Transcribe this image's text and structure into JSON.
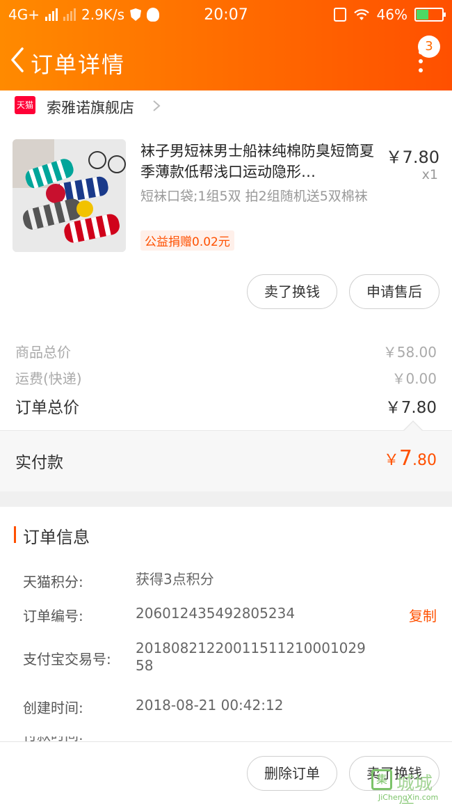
{
  "status_bar": {
    "network": "4G+",
    "speed": "2.9K/s",
    "time": "20:07",
    "battery": "46%",
    "battery_level": 0.46
  },
  "header": {
    "title": "订单详情",
    "badge": "3"
  },
  "shop": {
    "logo_text": "天猫",
    "name": "索雅诺旗舰店"
  },
  "product": {
    "name": "袜子男短袜男士船袜纯棉防臭短筒夏季薄款低帮浅口运动隐形…",
    "price": "￥7.80",
    "quantity": "x1",
    "sku": "短袜口袋;1组5双 拍2组随机送5双棉袜",
    "charity": "公益捐赠0.02元",
    "actions": [
      "卖了换钱",
      "申请售后"
    ]
  },
  "totals": {
    "goods_label": "商品总价",
    "goods_value": "￥58.00",
    "shipping_label": "运费(快递)",
    "shipping_value": "￥0.00",
    "order_total_label": "订单总价",
    "order_total_value": "￥7.80",
    "paid_label": "实付款",
    "paid_currency": "￥",
    "paid_integer": "7",
    "paid_decimal": ".80"
  },
  "order_info": {
    "title": "订单信息",
    "rows": [
      {
        "label": "天猫积分:",
        "value": "获得3点积分"
      },
      {
        "label": "订单编号:",
        "value": "206012435492805234",
        "action": "复制"
      },
      {
        "label": "支付宝交易号:",
        "value": "2018082122001151121000102958"
      },
      {
        "label": "创建时间:",
        "value": "2018-08-21 00:42:12"
      },
      {
        "label": "付款时间:",
        "value": ""
      }
    ]
  },
  "bottom_actions": [
    "删除订单",
    "卖了换钱"
  ],
  "watermark": {
    "mark": "集",
    "text": "城城信",
    "sub": "JiChengXin.com"
  },
  "colors": {
    "header_start": "#ff8a00",
    "header_end": "#ff5000",
    "accent": "#ff5000",
    "tmall_red": "#ff0036"
  }
}
